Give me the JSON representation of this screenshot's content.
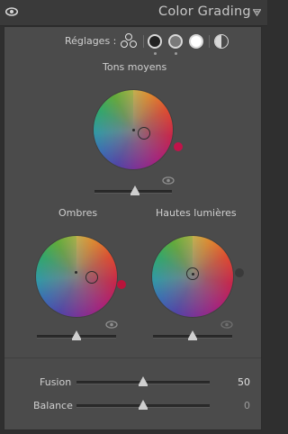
{
  "header": {
    "title": "Color Grading",
    "visibility_icon": "eye-icon",
    "collapse_icon": "triangle-down-icon"
  },
  "adjust": {
    "label": "Réglages :",
    "modes": [
      {
        "name": "three-way-icon",
        "selected": true
      },
      {
        "name": "shadows-mode-icon",
        "selected": false
      },
      {
        "name": "midtones-mode-icon",
        "selected": false
      },
      {
        "name": "highlights-mode-icon",
        "selected": false
      },
      {
        "name": "global-mode-icon",
        "selected": false
      }
    ]
  },
  "midtones": {
    "label": "Tons moyens",
    "dot_color": "#c0134a"
  },
  "shadows": {
    "label": "Ombres",
    "dot_color": "#b8143b"
  },
  "highlights": {
    "label": "Hautes lumières",
    "dot_color": "#3a3a3a"
  },
  "blending": {
    "label": "Fusion",
    "value": "50"
  },
  "balance": {
    "label": "Balance",
    "value": "0"
  }
}
